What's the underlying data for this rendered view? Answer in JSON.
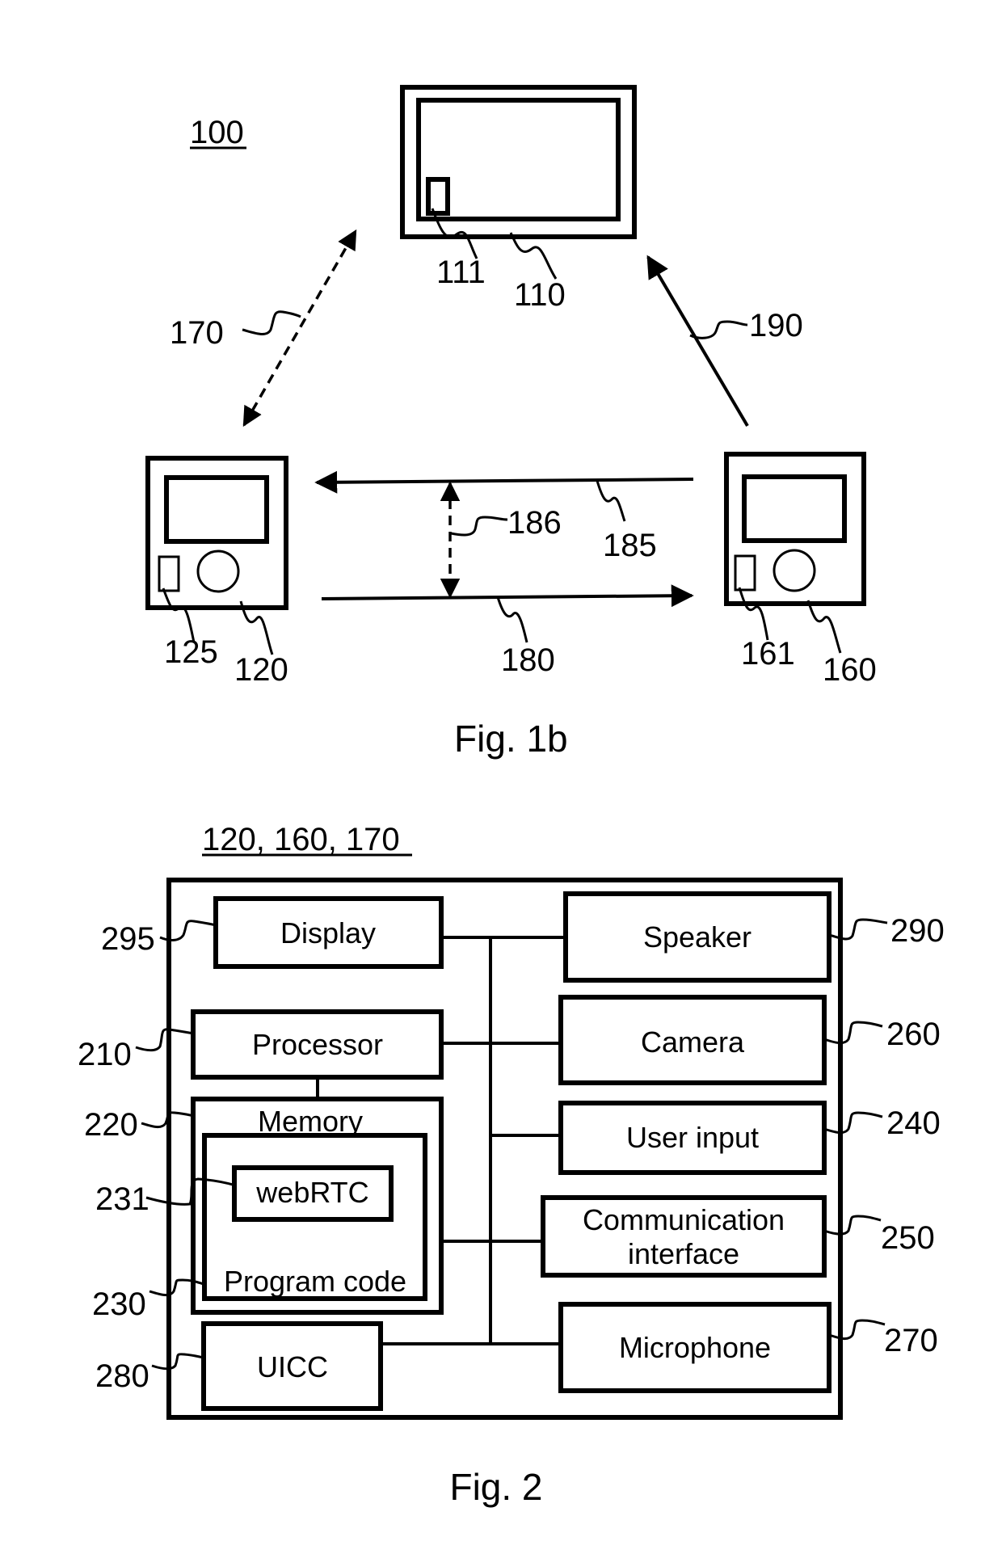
{
  "fig1b": {
    "system_ref": "100",
    "caption": "Fig. 1b",
    "screen": {
      "ref": "110",
      "component_ref": "111"
    },
    "device_left": {
      "ref": "120",
      "component_ref": "125"
    },
    "device_right": {
      "ref": "160",
      "component_ref": "161"
    },
    "links": {
      "dashed_diagonal": "170",
      "solid_diagonal": "190",
      "bottom_arrow": "180",
      "top_arrow": "185",
      "vertical_dashed": "186"
    }
  },
  "fig2": {
    "header_ref": "120, 160, 170",
    "caption": "Fig. 2",
    "blocks": {
      "display": {
        "label": "Display",
        "ref": "295"
      },
      "processor": {
        "label": "Processor",
        "ref": "210"
      },
      "memory": {
        "label": "Memory",
        "ref": "220"
      },
      "webrtc": {
        "label": "webRTC",
        "ref": "231"
      },
      "program_code": {
        "label": "Program code",
        "ref": "230"
      },
      "uicc": {
        "label": "UICC",
        "ref": "280"
      },
      "speaker": {
        "label": "Speaker",
        "ref": "290"
      },
      "camera": {
        "label": "Camera",
        "ref": "260"
      },
      "user_input": {
        "label": "User input",
        "ref": "240"
      },
      "comm_interface": {
        "label_line1": "Communication",
        "label_line2": "interface",
        "ref": "250"
      },
      "microphone": {
        "label": "Microphone",
        "ref": "270"
      }
    }
  }
}
